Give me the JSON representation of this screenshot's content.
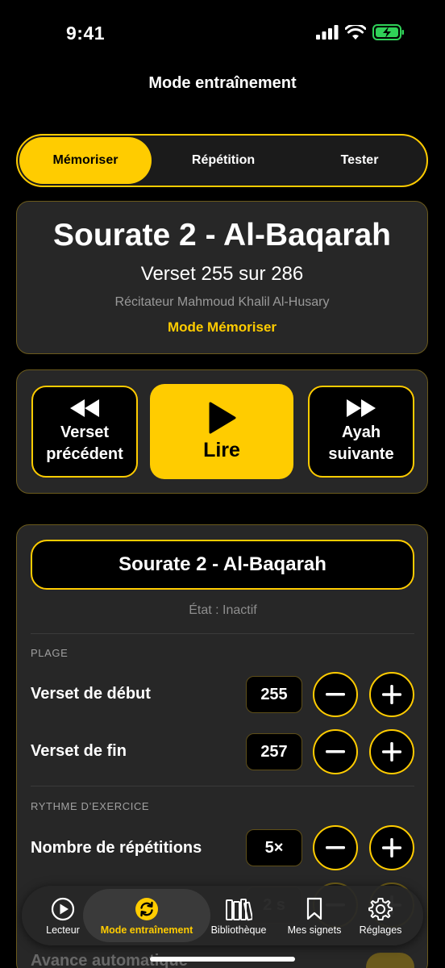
{
  "status": {
    "time": "9:41"
  },
  "nav": {
    "title": "Mode entraînement"
  },
  "segments": [
    "Mémoriser",
    "Répétition",
    "Tester"
  ],
  "info": {
    "title": "Sourate 2 - Al-Baqarah",
    "verse": "Verset 255 sur 286",
    "reciter": "Récitateur Mahmoud Khalil Al-Husary",
    "mode": "Mode Mémoriser"
  },
  "controls": {
    "prev_line1": "Verset",
    "prev_line2": "précédent",
    "play": "Lire",
    "next_line1": "Ayah",
    "next_line2": "suivante"
  },
  "settings": {
    "surah": "Sourate 2 - Al-Baqarah",
    "state": "État : Inactif",
    "section_range": "PLAGE",
    "start_label": "Verset de début",
    "start_value": "255",
    "end_label": "Verset de fin",
    "end_value": "257",
    "section_rhythm": "RYTHME D’EXERCICE",
    "reps_label": "Nombre de répétitions",
    "reps_value": "5×",
    "partial_value": "2 s",
    "autoadvance_label": "Avance automatique"
  },
  "tabs": [
    {
      "label": "Lecteur",
      "icon": "play-circle-icon"
    },
    {
      "label": "Mode entraînement",
      "icon": "repeat-icon"
    },
    {
      "label": "Bibliothèque",
      "icon": "books-icon"
    },
    {
      "label": "Mes signets",
      "icon": "bookmark-icon"
    },
    {
      "label": "Réglages",
      "icon": "gear-icon"
    }
  ],
  "colors": {
    "accent": "#FFCC00",
    "background": "#000000",
    "card": "#272727"
  }
}
